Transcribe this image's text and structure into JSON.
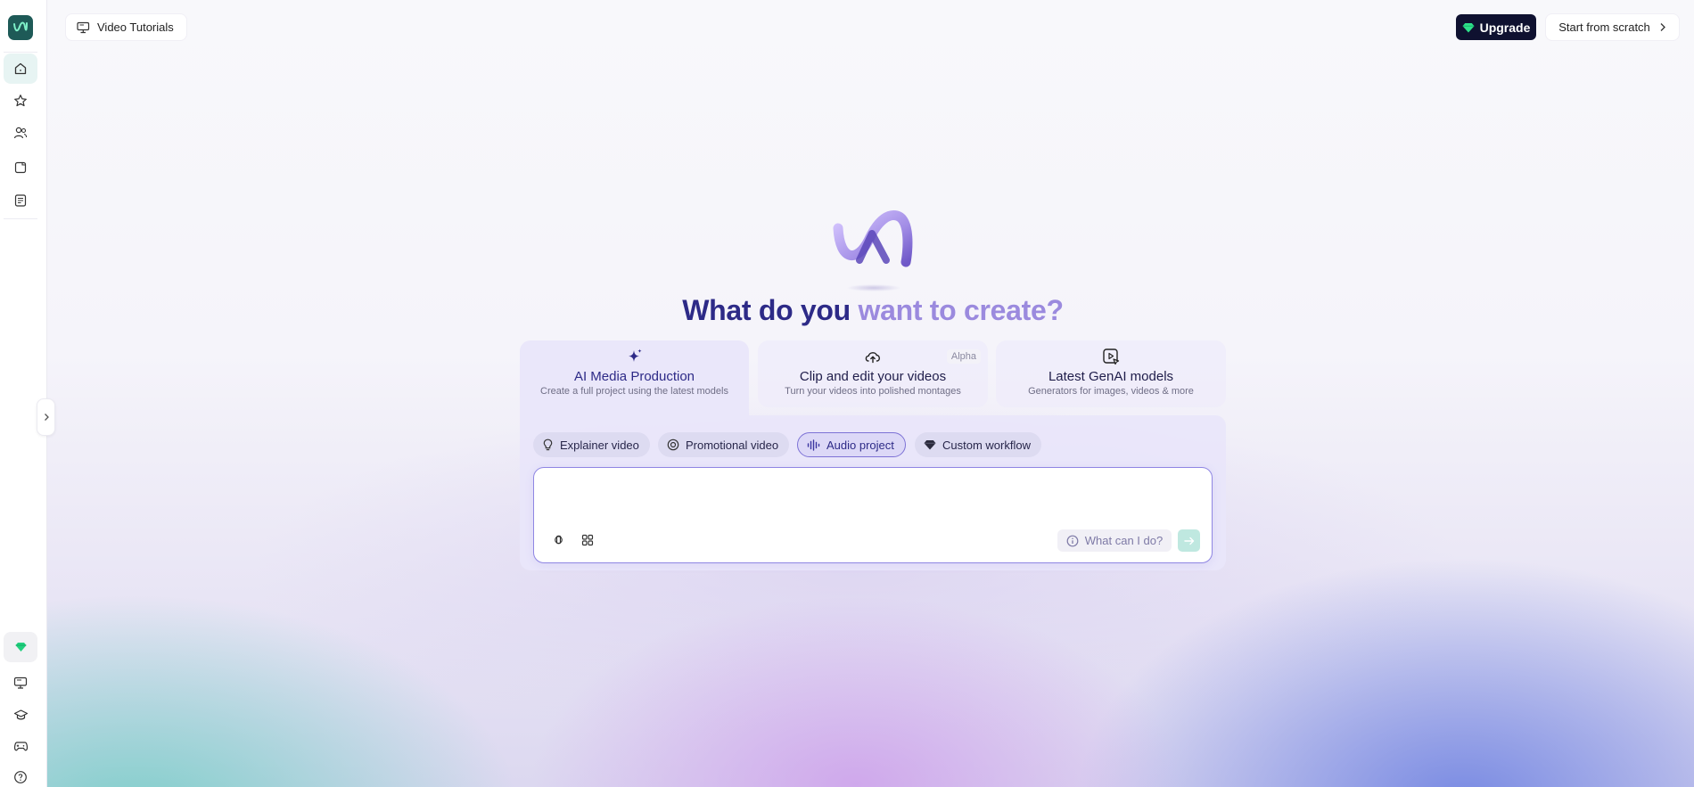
{
  "header": {
    "tutorials_label": "Video Tutorials",
    "upgrade_label": "Upgrade",
    "scratch_label": "Start from scratch"
  },
  "sidebar": {
    "items": [
      {
        "icon": "home-icon",
        "active": true
      },
      {
        "icon": "star-icon",
        "active": false
      },
      {
        "icon": "users-icon",
        "active": false
      },
      {
        "icon": "folder-icon",
        "active": false
      },
      {
        "icon": "document-icon",
        "active": false
      }
    ],
    "bottom_items": [
      "gem-icon",
      "monitor-icon",
      "graduation-cap-icon",
      "gamepad-icon",
      "help-icon"
    ]
  },
  "hero": {
    "headline_part1": "What do you ",
    "headline_part2": "want to create?"
  },
  "cards": [
    {
      "title": "AI Media Production",
      "subtitle": "Create a full project using the latest models",
      "icon": "sparkle-icon",
      "active": true
    },
    {
      "title": "Clip and edit your videos",
      "subtitle": "Turn your videos into polished montages",
      "icon": "cloud-upload-icon",
      "badge": "Alpha"
    },
    {
      "title": "Latest GenAI models",
      "subtitle": "Generators for images, videos & more",
      "icon": "image-cursor-icon"
    }
  ],
  "chips": [
    {
      "label": "Explainer video",
      "icon": "lightbulb-icon"
    },
    {
      "label": "Promotional video",
      "icon": "target-icon"
    },
    {
      "label": "Audio project",
      "icon": "audio-wave-icon",
      "selected": true
    },
    {
      "label": "Custom workflow",
      "icon": "gem-icon"
    }
  ],
  "prompt": {
    "placeholder": "",
    "help_label": "What can I do?"
  },
  "colors": {
    "accent": "#2d2a87",
    "accent_light": "#9b8ade",
    "upgrade_bg": "#0f1130",
    "brand_green": "#1e5a57",
    "gem_green": "#22d07e"
  }
}
